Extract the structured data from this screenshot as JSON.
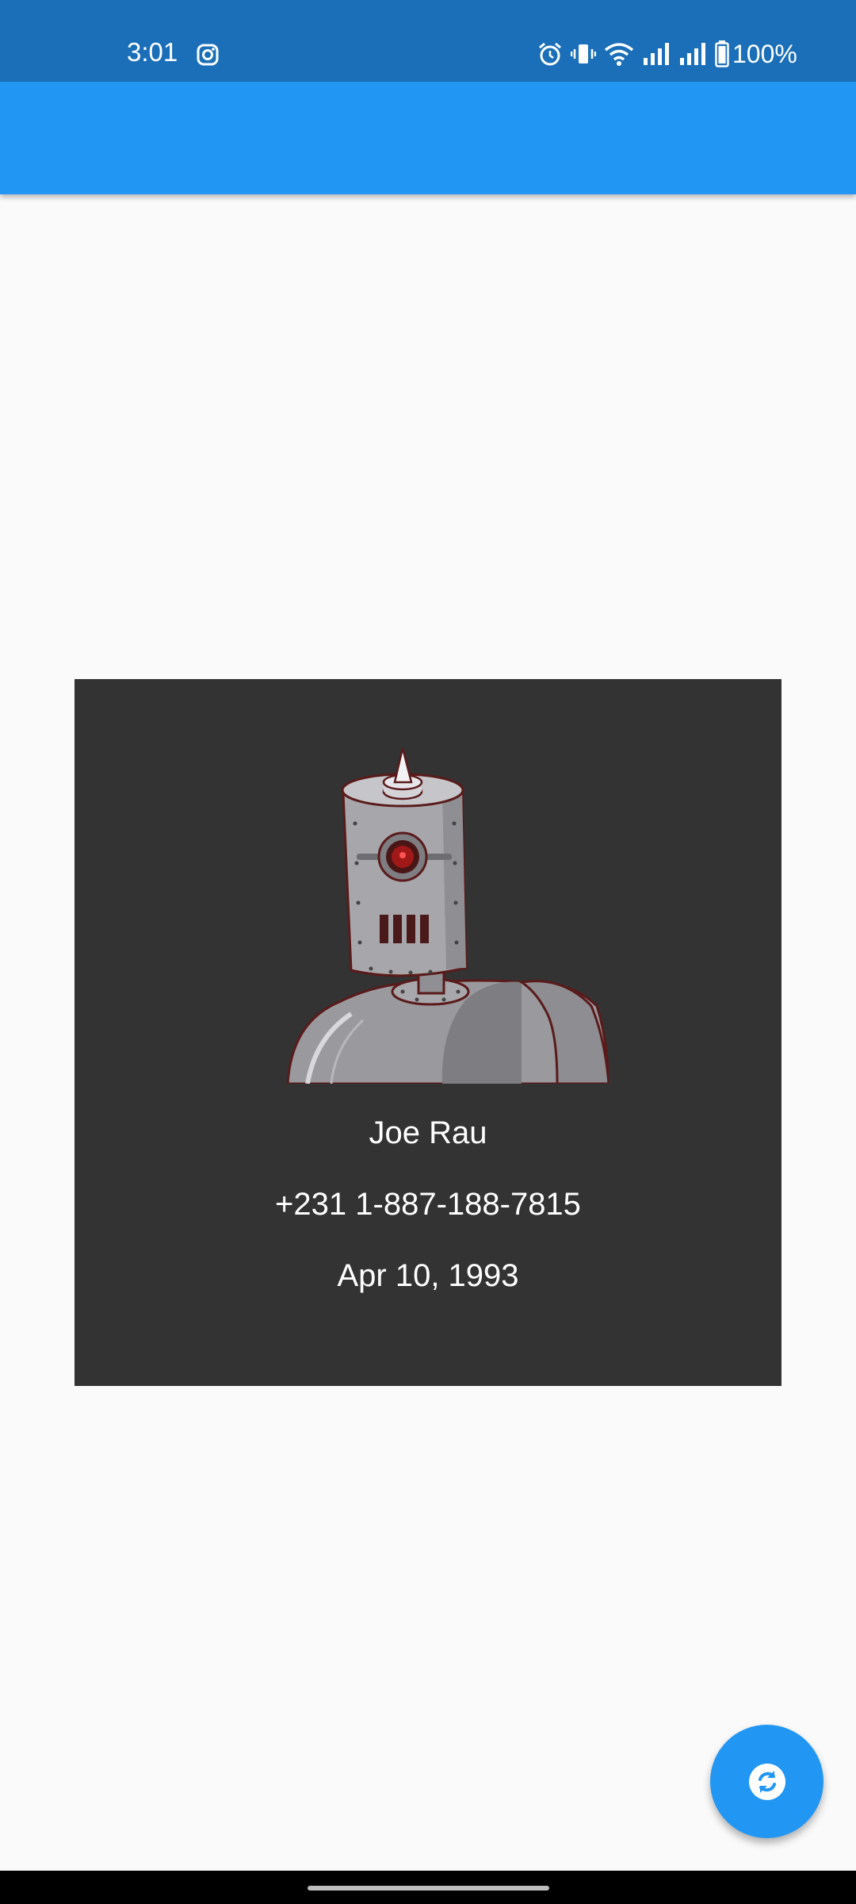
{
  "status_bar": {
    "time": "3:01",
    "battery_percent": "100%",
    "icons": [
      "instagram-icon",
      "alarm-icon",
      "vibrate-icon",
      "wifi-icon",
      "signal-icon",
      "signal-icon",
      "battery-icon"
    ]
  },
  "app_bar": {
    "title": "",
    "color": "#2196f3"
  },
  "profile": {
    "avatar_icon": "robot-avatar",
    "name": "Joe Rau",
    "phone": "+231 1-887-188-7815",
    "birthday": "Apr 10, 1993"
  },
  "fab": {
    "icon": "refresh-icon",
    "color": "#2196f3"
  }
}
